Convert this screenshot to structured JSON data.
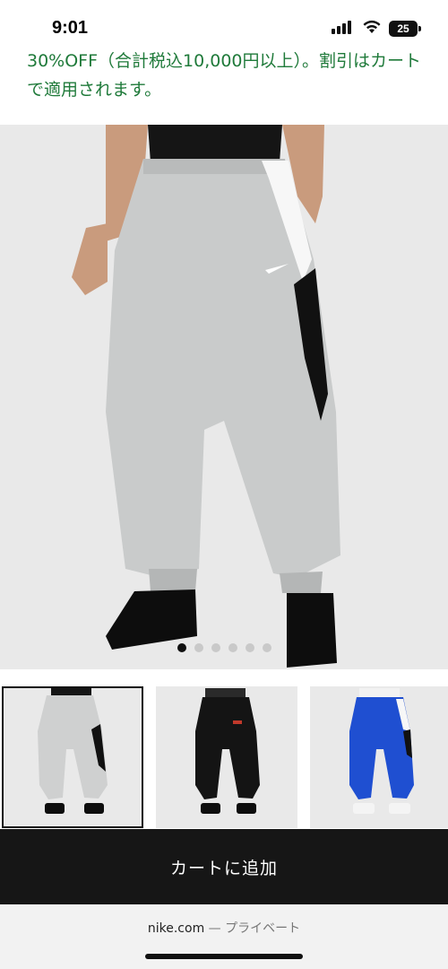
{
  "status_bar": {
    "time": "9:01",
    "battery": "25",
    "icons": [
      "cellular-signal-icon",
      "wifi-icon",
      "battery-icon"
    ]
  },
  "promo": {
    "text": "30%OFF（合計税込10,000円以上）。割引はカートで適用されます。",
    "color": "#1f7a3a"
  },
  "product": {
    "image_label": "product-main-image",
    "carousel": {
      "total": 6,
      "active_index": 0
    },
    "thumbnails": [
      {
        "color_name": "light gray / white / black",
        "swatch": "#cfd0d0",
        "selected": true
      },
      {
        "color_name": "black",
        "swatch": "#141414",
        "selected": false
      },
      {
        "color_name": "royal blue",
        "swatch": "#1f4fd1",
        "selected": false
      }
    ]
  },
  "cart": {
    "label": "カートに追加"
  },
  "browser_footer": {
    "domain": "nike.com",
    "separator": "—",
    "mode": "プライベート"
  }
}
